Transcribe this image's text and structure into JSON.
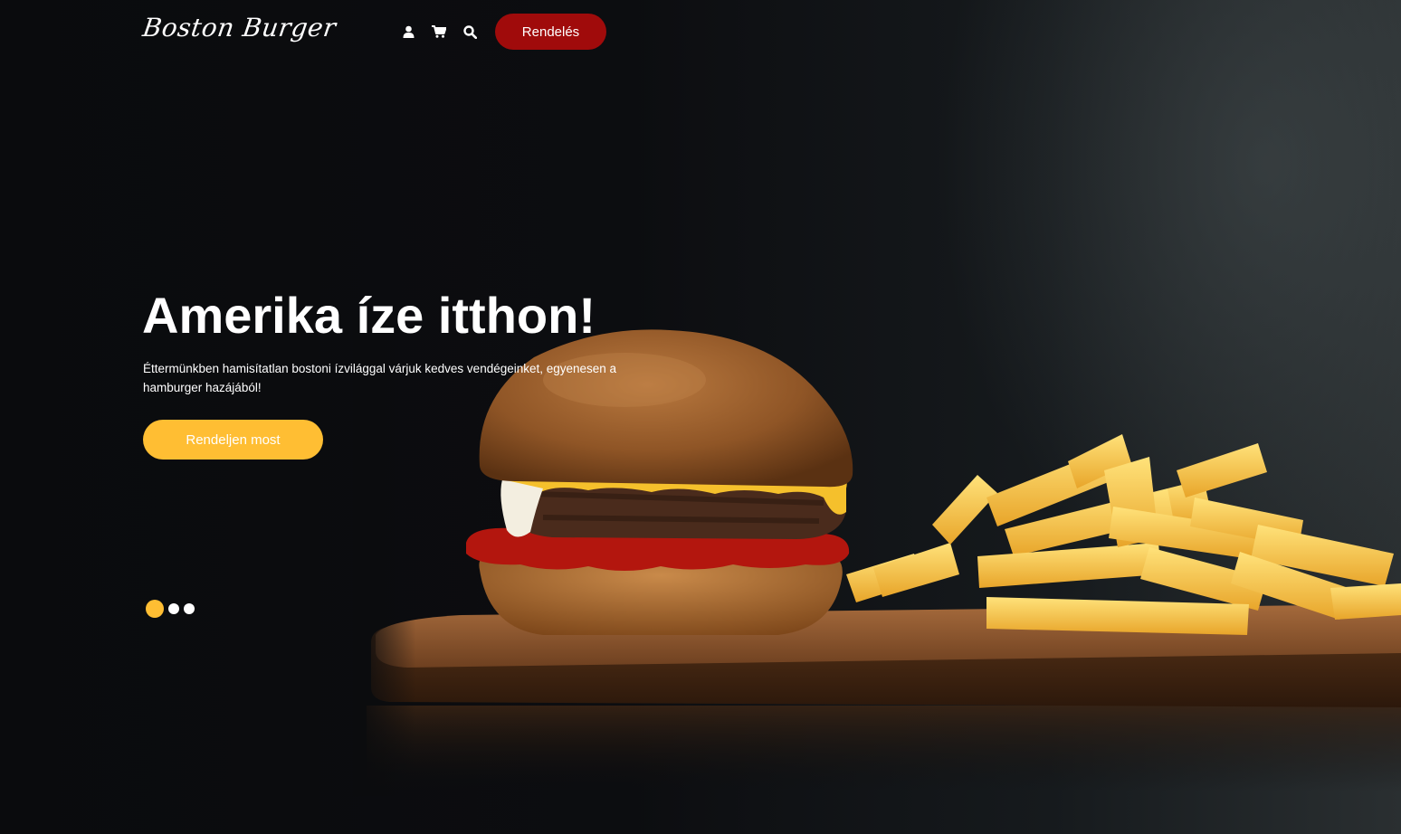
{
  "header": {
    "logo": "Boston Burger",
    "icons": [
      "user-icon",
      "cart-icon",
      "search-icon"
    ],
    "order_label": "Rendelés"
  },
  "hero": {
    "title": "Amerika íze itthon!",
    "text": "Éttermünkben hamisítatlan bostoni ízvilággal várjuk kedves vendégeinket, egyenesen a hamburger hazájából!",
    "cta_label": "Rendeljen most",
    "slides_count": 3,
    "active_slide": 1
  },
  "colors": {
    "accent": "#ffbe33",
    "brand_red": "#a00b0b",
    "background": "#0b0c0e"
  }
}
